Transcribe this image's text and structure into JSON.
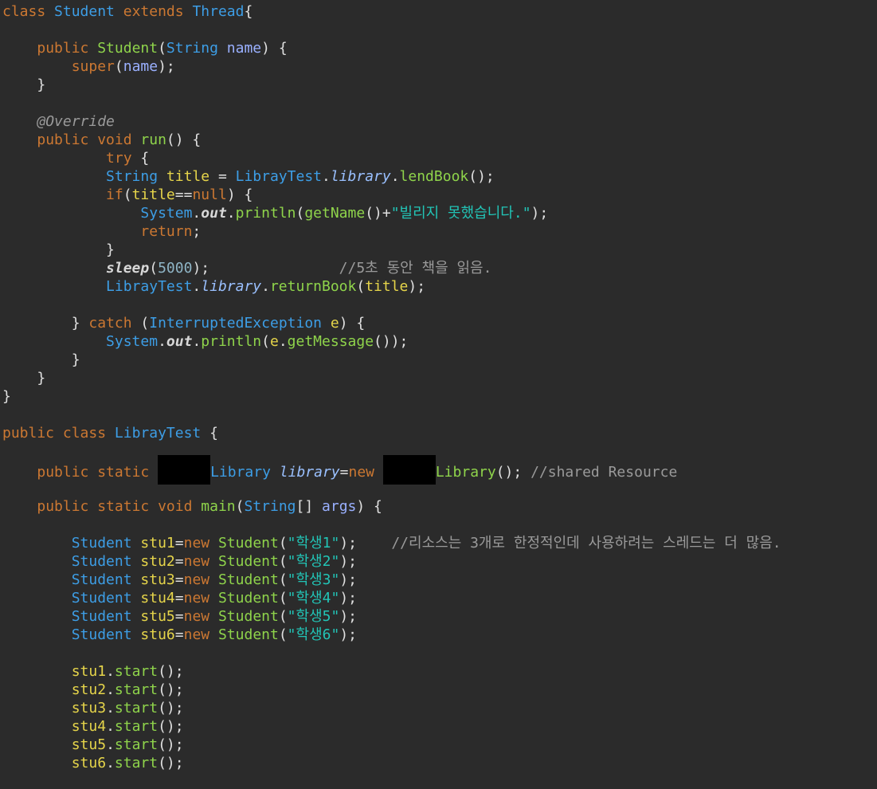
{
  "theme": {
    "background": "#2b2b2b",
    "keyword": "#cc7832",
    "type": "#3d9ee6",
    "function": "#8fd44b",
    "parameter": "#9ab0ff",
    "variable": "#e6d54a",
    "string": "#22c4b6",
    "number": "#8fb5c6",
    "comment": "#9a9a9a",
    "redaction": "#000000"
  },
  "code_lines": [
    [
      [
        "kw",
        "class "
      ],
      [
        "type",
        "Student "
      ],
      [
        "kw",
        "extends "
      ],
      [
        "type",
        "Thread"
      ],
      [
        "punct",
        "{"
      ]
    ],
    [],
    [
      [
        "plain",
        "    "
      ],
      [
        "kw",
        "public "
      ],
      [
        "func",
        "Student"
      ],
      [
        "punct",
        "("
      ],
      [
        "type",
        "String "
      ],
      [
        "param",
        "name"
      ],
      [
        "punct",
        ") {"
      ]
    ],
    [
      [
        "plain",
        "        "
      ],
      [
        "kw",
        "super"
      ],
      [
        "punct",
        "("
      ],
      [
        "param",
        "name"
      ],
      [
        "punct",
        ");"
      ]
    ],
    [
      [
        "plain",
        "    "
      ],
      [
        "punct",
        "}"
      ]
    ],
    [],
    [
      [
        "plain",
        "    "
      ],
      [
        "ann",
        "@Override"
      ]
    ],
    [
      [
        "plain",
        "    "
      ],
      [
        "kw",
        "public void "
      ],
      [
        "func",
        "run"
      ],
      [
        "punct",
        "() {"
      ]
    ],
    [
      [
        "plain",
        "            "
      ],
      [
        "kw",
        "try "
      ],
      [
        "punct",
        "{"
      ]
    ],
    [
      [
        "plain",
        "            "
      ],
      [
        "type",
        "String "
      ],
      [
        "var",
        "title "
      ],
      [
        "punct",
        "= "
      ],
      [
        "type",
        "LibrayTest"
      ],
      [
        "punct",
        "."
      ],
      [
        "italic",
        "library"
      ],
      [
        "punct",
        "."
      ],
      [
        "func",
        "lendBook"
      ],
      [
        "punct",
        "();"
      ]
    ],
    [
      [
        "plain",
        "            "
      ],
      [
        "kw",
        "if"
      ],
      [
        "punct",
        "("
      ],
      [
        "var",
        "title"
      ],
      [
        "punct",
        "=="
      ],
      [
        "kw",
        "null"
      ],
      [
        "punct",
        ") {"
      ]
    ],
    [
      [
        "plain",
        "                "
      ],
      [
        "type",
        "System"
      ],
      [
        "punct",
        "."
      ],
      [
        "static",
        "out"
      ],
      [
        "punct",
        "."
      ],
      [
        "func",
        "println"
      ],
      [
        "punct",
        "("
      ],
      [
        "func",
        "getName"
      ],
      [
        "punct",
        "()+"
      ],
      [
        "str",
        "\"빌리지 못했습니다.\""
      ],
      [
        "punct",
        ");"
      ]
    ],
    [
      [
        "plain",
        "                "
      ],
      [
        "kw",
        "return"
      ],
      [
        "punct",
        ";"
      ]
    ],
    [
      [
        "plain",
        "            "
      ],
      [
        "punct",
        "}"
      ]
    ],
    [
      [
        "plain",
        "            "
      ],
      [
        "static",
        "sleep"
      ],
      [
        "punct",
        "("
      ],
      [
        "num",
        "5000"
      ],
      [
        "punct",
        ");               "
      ],
      [
        "cmt",
        "//5초 동안 책을 읽음."
      ]
    ],
    [
      [
        "plain",
        "            "
      ],
      [
        "type",
        "LibrayTest"
      ],
      [
        "punct",
        "."
      ],
      [
        "italic",
        "library"
      ],
      [
        "punct",
        "."
      ],
      [
        "func",
        "returnBook"
      ],
      [
        "punct",
        "("
      ],
      [
        "var",
        "title"
      ],
      [
        "punct",
        ");"
      ]
    ],
    [],
    [
      [
        "plain",
        "        "
      ],
      [
        "punct",
        "} "
      ],
      [
        "kw",
        "catch "
      ],
      [
        "punct",
        "("
      ],
      [
        "type",
        "InterruptedException "
      ],
      [
        "var",
        "e"
      ],
      [
        "punct",
        ") {"
      ]
    ],
    [
      [
        "plain",
        "            "
      ],
      [
        "type",
        "System"
      ],
      [
        "punct",
        "."
      ],
      [
        "static",
        "out"
      ],
      [
        "punct",
        "."
      ],
      [
        "func",
        "println"
      ],
      [
        "punct",
        "("
      ],
      [
        "var",
        "e"
      ],
      [
        "punct",
        "."
      ],
      [
        "func",
        "getMessage"
      ],
      [
        "punct",
        "());"
      ]
    ],
    [
      [
        "plain",
        "        "
      ],
      [
        "punct",
        "}"
      ]
    ],
    [
      [
        "plain",
        "    "
      ],
      [
        "punct",
        "}"
      ]
    ],
    [
      [
        "punct",
        "}"
      ]
    ],
    [],
    [
      [
        "kw",
        "public class "
      ],
      [
        "type",
        "LibrayTest "
      ],
      [
        "punct",
        "{"
      ]
    ],
    [],
    [
      [
        "plain",
        "    "
      ],
      [
        "kw",
        "public static "
      ],
      [
        "redact",
        "      "
      ],
      [
        "type",
        "Library "
      ],
      [
        "italic",
        "library"
      ],
      [
        "punct",
        "="
      ],
      [
        "kw",
        "new "
      ],
      [
        "redact",
        "      "
      ],
      [
        "func",
        "Library"
      ],
      [
        "punct",
        "(); "
      ],
      [
        "cmt",
        "//shared Resource"
      ]
    ],
    [],
    [
      [
        "plain",
        "    "
      ],
      [
        "kw",
        "public static void "
      ],
      [
        "func",
        "main"
      ],
      [
        "punct",
        "("
      ],
      [
        "type",
        "String"
      ],
      [
        "punct",
        "[] "
      ],
      [
        "param",
        "args"
      ],
      [
        "punct",
        ") {"
      ]
    ],
    [],
    [
      [
        "plain",
        "        "
      ],
      [
        "type",
        "Student "
      ],
      [
        "var",
        "stu1"
      ],
      [
        "punct",
        "="
      ],
      [
        "kw",
        "new "
      ],
      [
        "func",
        "Student"
      ],
      [
        "punct",
        "("
      ],
      [
        "str",
        "\"학생1\""
      ],
      [
        "punct",
        ");    "
      ],
      [
        "cmt",
        "//리소스는 3개로 한정적인데 사용하려는 스레드는 더 많음."
      ]
    ],
    [
      [
        "plain",
        "        "
      ],
      [
        "type",
        "Student "
      ],
      [
        "var",
        "stu2"
      ],
      [
        "punct",
        "="
      ],
      [
        "kw",
        "new "
      ],
      [
        "func",
        "Student"
      ],
      [
        "punct",
        "("
      ],
      [
        "str",
        "\"학생2\""
      ],
      [
        "punct",
        ");"
      ]
    ],
    [
      [
        "plain",
        "        "
      ],
      [
        "type",
        "Student "
      ],
      [
        "var",
        "stu3"
      ],
      [
        "punct",
        "="
      ],
      [
        "kw",
        "new "
      ],
      [
        "func",
        "Student"
      ],
      [
        "punct",
        "("
      ],
      [
        "str",
        "\"학생3\""
      ],
      [
        "punct",
        ");"
      ]
    ],
    [
      [
        "plain",
        "        "
      ],
      [
        "type",
        "Student "
      ],
      [
        "var",
        "stu4"
      ],
      [
        "punct",
        "="
      ],
      [
        "kw",
        "new "
      ],
      [
        "func",
        "Student"
      ],
      [
        "punct",
        "("
      ],
      [
        "str",
        "\"학생4\""
      ],
      [
        "punct",
        ");"
      ]
    ],
    [
      [
        "plain",
        "        "
      ],
      [
        "type",
        "Student "
      ],
      [
        "var",
        "stu5"
      ],
      [
        "punct",
        "="
      ],
      [
        "kw",
        "new "
      ],
      [
        "func",
        "Student"
      ],
      [
        "punct",
        "("
      ],
      [
        "str",
        "\"학생5\""
      ],
      [
        "punct",
        ");"
      ]
    ],
    [
      [
        "plain",
        "        "
      ],
      [
        "type",
        "Student "
      ],
      [
        "var",
        "stu6"
      ],
      [
        "punct",
        "="
      ],
      [
        "kw",
        "new "
      ],
      [
        "func",
        "Student"
      ],
      [
        "punct",
        "("
      ],
      [
        "str",
        "\"학생6\""
      ],
      [
        "punct",
        ");"
      ]
    ],
    [],
    [
      [
        "plain",
        "        "
      ],
      [
        "var",
        "stu1"
      ],
      [
        "punct",
        "."
      ],
      [
        "func",
        "start"
      ],
      [
        "punct",
        "();"
      ]
    ],
    [
      [
        "plain",
        "        "
      ],
      [
        "var",
        "stu2"
      ],
      [
        "punct",
        "."
      ],
      [
        "func",
        "start"
      ],
      [
        "punct",
        "();"
      ]
    ],
    [
      [
        "plain",
        "        "
      ],
      [
        "var",
        "stu3"
      ],
      [
        "punct",
        "."
      ],
      [
        "func",
        "start"
      ],
      [
        "punct",
        "();"
      ]
    ],
    [
      [
        "plain",
        "        "
      ],
      [
        "var",
        "stu4"
      ],
      [
        "punct",
        "."
      ],
      [
        "func",
        "start"
      ],
      [
        "punct",
        "();"
      ]
    ],
    [
      [
        "plain",
        "        "
      ],
      [
        "var",
        "stu5"
      ],
      [
        "punct",
        "."
      ],
      [
        "func",
        "start"
      ],
      [
        "punct",
        "();"
      ]
    ],
    [
      [
        "plain",
        "        "
      ],
      [
        "var",
        "stu6"
      ],
      [
        "punct",
        "."
      ],
      [
        "func",
        "start"
      ],
      [
        "punct",
        "();"
      ]
    ]
  ]
}
